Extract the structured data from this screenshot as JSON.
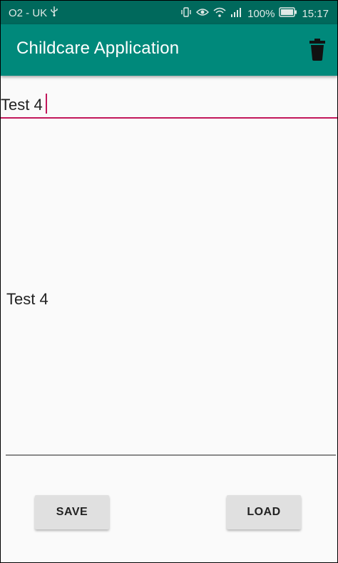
{
  "status_bar": {
    "carrier": "O2 - UK",
    "battery_percent": "100%",
    "time": "15:17",
    "icons": [
      "usb-icon",
      "vibrate-icon",
      "eye-icon",
      "wifi-icon",
      "signal-icon",
      "battery-icon"
    ]
  },
  "app_bar": {
    "title": "Childcare Application",
    "action_icon": "trash-icon"
  },
  "edit_field": {
    "value": "Test 4"
  },
  "display": {
    "text": "Test 4"
  },
  "buttons": {
    "save_label": "SAVE",
    "load_label": "LOAD"
  },
  "colors": {
    "status_bar": "#00695c",
    "app_bar": "#00897b",
    "accent": "#c2185b",
    "background": "#fafafa",
    "button": "#e0e0e0"
  }
}
